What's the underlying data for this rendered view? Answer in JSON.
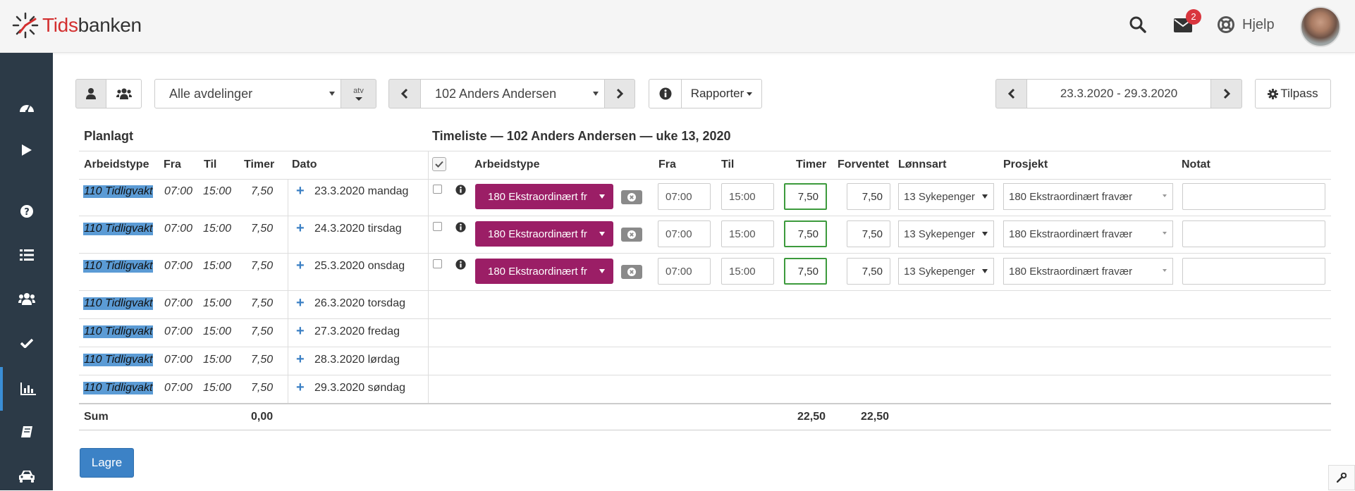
{
  "brand": {
    "logo_red": "Tids",
    "logo_dark": "banken"
  },
  "topbar": {
    "mail_count": "2",
    "help_label": "Hjelp"
  },
  "sidebar": {
    "items": [
      "dashboard-icon",
      "play-icon",
      "help-icon",
      "list-icon",
      "users-icon",
      "check-icon",
      "chart-icon",
      "book-icon",
      "car-icon"
    ],
    "active": "chart-icon"
  },
  "toolbar": {
    "department": "Alle avdelinger",
    "atv_label": "atv",
    "employee": "102 Anders Andersen",
    "reports_label": "Rapporter",
    "date_range": "23.3.2020 - 29.3.2020",
    "customize_label": "Tilpass"
  },
  "planned": {
    "title": "Planlagt",
    "columns": [
      "Arbeidstype",
      "Fra",
      "Til",
      "Timer",
      "Dato"
    ],
    "rows": [
      {
        "type": "110 Tidligvakt",
        "from": "07:00",
        "to": "15:00",
        "hours": "7,50",
        "date": "23.3.2020 mandag"
      },
      {
        "type": "110 Tidligvakt",
        "from": "07:00",
        "to": "15:00",
        "hours": "7,50",
        "date": "24.3.2020 tirsdag"
      },
      {
        "type": "110 Tidligvakt",
        "from": "07:00",
        "to": "15:00",
        "hours": "7,50",
        "date": "25.3.2020 onsdag"
      },
      {
        "type": "110 Tidligvakt",
        "from": "07:00",
        "to": "15:00",
        "hours": "7,50",
        "date": "26.3.2020 torsdag"
      },
      {
        "type": "110 Tidligvakt",
        "from": "07:00",
        "to": "15:00",
        "hours": "7,50",
        "date": "27.3.2020 fredag"
      },
      {
        "type": "110 Tidligvakt",
        "from": "07:00",
        "to": "15:00",
        "hours": "7,50",
        "date": "28.3.2020 lørdag"
      },
      {
        "type": "110 Tidligvakt",
        "from": "07:00",
        "to": "15:00",
        "hours": "7,50",
        "date": "29.3.2020 søndag"
      }
    ],
    "sum_label": "Sum",
    "sum_hours": "0,00"
  },
  "timesheet": {
    "title": "Timeliste — 102 Anders Andersen — uke 13, 2020",
    "columns": [
      "Arbeidstype",
      "Fra",
      "Til",
      "Timer",
      "Forventet",
      "Lønnsart",
      "Prosjekt",
      "Notat"
    ],
    "rows": [
      {
        "type": "180 Ekstraordinært fr",
        "from": "07:00",
        "to": "15:00",
        "hours": "7,50",
        "expected": "7,50",
        "wage": "13 Sykepenger",
        "project": "180 Ekstraordinært fravær",
        "note": ""
      },
      {
        "type": "180 Ekstraordinært fr",
        "from": "07:00",
        "to": "15:00",
        "hours": "7,50",
        "expected": "7,50",
        "wage": "13 Sykepenger",
        "project": "180 Ekstraordinært fravær",
        "note": ""
      },
      {
        "type": "180 Ekstraordinært fr",
        "from": "07:00",
        "to": "15:00",
        "hours": "7,50",
        "expected": "7,50",
        "wage": "13 Sykepenger",
        "project": "180 Ekstraordinært fravær",
        "note": ""
      }
    ],
    "sum_hours": "22,50",
    "sum_expected": "22,50"
  },
  "save_label": "Lagre",
  "colors": {
    "sidebar": "#2c3a47",
    "accent": "#3c82c6",
    "worktype": "#9b1e66",
    "highlight": "#5b9bd5",
    "badge": "#d9363e"
  }
}
